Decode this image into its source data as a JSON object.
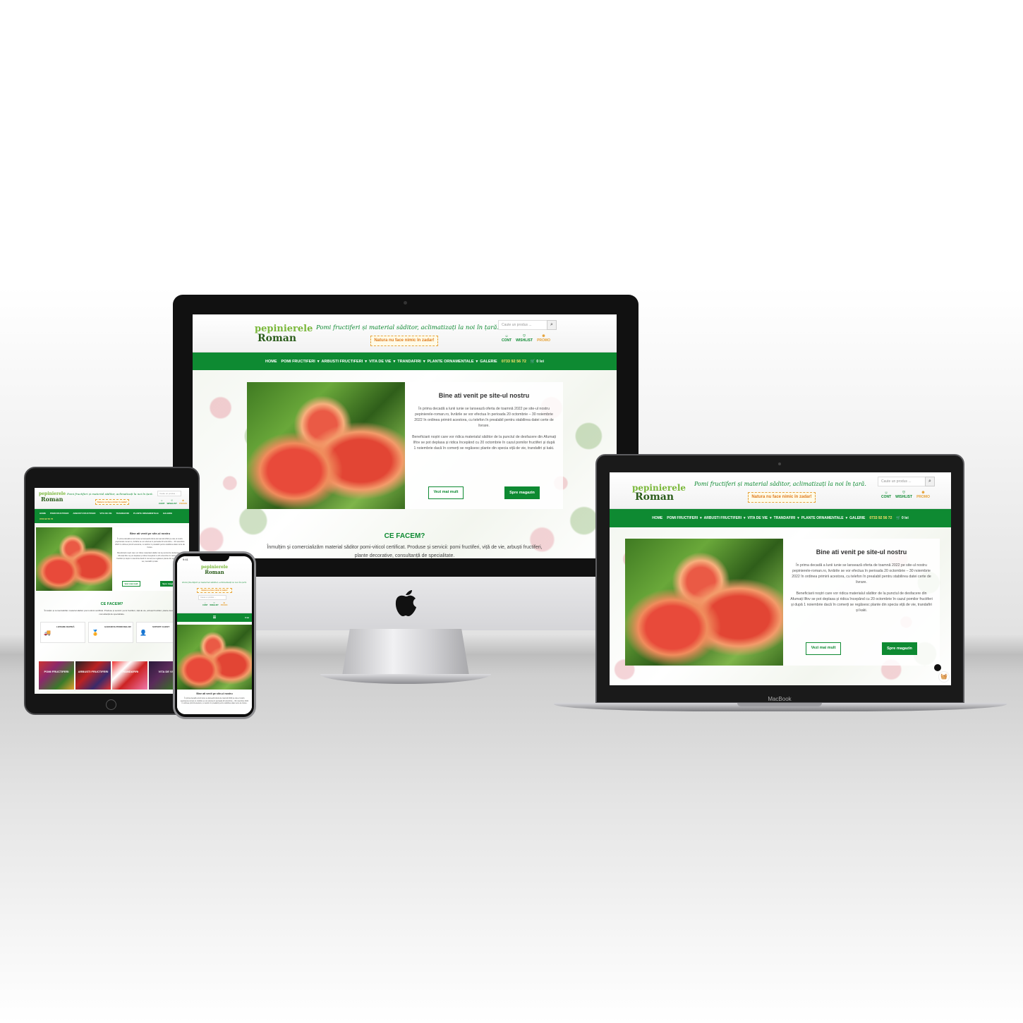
{
  "site": {
    "logo_top": "pepinierele",
    "logo_bottom": "Roman",
    "tagline": "Pomi fructiferi și material săditor, aclimatizați la noi în țară.",
    "motto": "Natura nu face nimic în zadar!",
    "search_placeholder": "Caute un produs ...",
    "account_label": "CONT",
    "wishlist_label": "WISHLIST",
    "promo_label": "PROMO",
    "nav": [
      "HOME",
      "POMI FRUCTIFERI",
      "ARBUSTI FRUCTIFERI",
      "VITA DE VIE",
      "TRANDAFIRI",
      "PLANTE ORNAMENTALE",
      "GALERIE"
    ],
    "phone": "0733 92 56 72",
    "cart_total": "0 lei",
    "welcome_title": "Bine ati venit pe site-ul nostru",
    "welcome_p1": "În prima decadă a lunii iunie se lansează oferta de toamnă 2022 pe site-ul nostru pepinierele-roman.ro, livrările se vor efectua în perioada 20 octombrie – 30 noiembrie 2022 în ordinea primirii acestora, cu telefon în prealabil pentru stabilirea datei certe de livrare.",
    "welcome_p2": "Beneficiarii noștri care vor ridica materialul săditor de la punctul de desfacere din Afumați Ilfov se pot deplasa și ridica începând cu 20 octombrie în cazul pomilor fructiferi și după 1 noiembrie dacă în comerți se regăsesc plante din specia viță de vie, trandafiri și kaki.",
    "btn_more": "Vezi mai mult",
    "btn_shop": "Spre magazin",
    "cef_title": "CE FACEM?",
    "cef_text": "Înmulțim și comercializăm material săditor pomi-viticol certificat. Produse și servicii: pomi fructiferi, viță de vie, arbuști fructiferi, plante decorative, consultanță de specialitate.",
    "features": [
      "LIVRARE RAPIDĂ",
      "GARANȚIA PRODUSELOR",
      "SUPORT CLIENT"
    ],
    "categories": [
      "POMI FRUCTIFERI",
      "ARBUSTI FRUCTIFERI",
      "TRANDAFIRI",
      "VITA DE VIE"
    ],
    "phone_time": "9:41"
  },
  "devices": {
    "laptop_brand": "MacBook"
  },
  "colors": {
    "brand_green": "#0e8a32",
    "accent_orange": "#e6a33a",
    "phone_yellow": "#ffe36b"
  }
}
